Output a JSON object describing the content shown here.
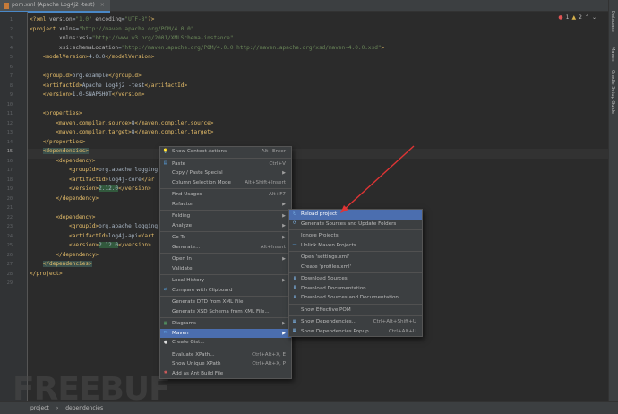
{
  "tab": {
    "title": "pom.xml (Apache Log4j2 -test)",
    "close": "×"
  },
  "inspection": {
    "errors": "1",
    "warnings": "2"
  },
  "right_tools": [
    "Database",
    "Maven",
    "Gradle Setup Guide"
  ],
  "code_lines": [
    {
      "n": "1",
      "html": "<span class=\"tg\">&lt;?xml </span><span class=\"at\">version</span>=<span class=\"av\">\"1.0\"</span> <span class=\"at\">encoding</span>=<span class=\"av\">\"UTF-8\"</span><span class=\"tg\">?&gt;</span>"
    },
    {
      "n": "2",
      "html": "<span class=\"tg\">&lt;project </span><span class=\"at\">xmlns</span>=<span class=\"av\">\"http://maven.apache.org/POM/4.0.0\"</span>"
    },
    {
      "n": "3",
      "html": "         <span class=\"at\">xmlns:xsi</span>=<span class=\"av\">\"http://www.w3.org/2001/XMLSchema-instance\"</span>"
    },
    {
      "n": "4",
      "html": "         <span class=\"at\">xsi:schemaLocation</span>=<span class=\"av\">\"http://maven.apache.org/POM/4.0.0 http://maven.apache.org/xsd/maven-4.0.0.xsd\"</span><span class=\"tg\">&gt;</span>"
    },
    {
      "n": "5",
      "html": "    <span class=\"tg\">&lt;modelVersion&gt;</span>4.0.0<span class=\"tg\">&lt;/modelVersion&gt;</span>"
    },
    {
      "n": "6",
      "html": ""
    },
    {
      "n": "7",
      "html": "    <span class=\"tg\">&lt;groupId&gt;</span>org.example<span class=\"tg\">&lt;/groupId&gt;</span>"
    },
    {
      "n": "8",
      "html": "    <span class=\"tg\">&lt;artifactId&gt;</span>Apache Log4j2 -test<span class=\"tg\">&lt;/artifactId&gt;</span>"
    },
    {
      "n": "9",
      "html": "    <span class=\"tg\">&lt;version&gt;</span>1.0-SNAPSHOT<span class=\"tg\">&lt;/version&gt;</span>"
    },
    {
      "n": "10",
      "html": ""
    },
    {
      "n": "11",
      "html": "    <span class=\"tg\">&lt;properties&gt;</span>"
    },
    {
      "n": "12",
      "html": "        <span class=\"tg\">&lt;maven.compiler.source&gt;</span>8<span class=\"tg\">&lt;/maven.compiler.source&gt;</span>"
    },
    {
      "n": "13",
      "html": "        <span class=\"tg\">&lt;maven.compiler.target&gt;</span>8<span class=\"tg\">&lt;/maven.compiler.target&gt;</span>"
    },
    {
      "n": "14",
      "html": "    <span class=\"tg\">&lt;/properties&gt;</span>"
    },
    {
      "n": "15",
      "html": "    <span class=\"tg hl\">&lt;dependencies&gt;</span>"
    },
    {
      "n": "16",
      "html": "        <span class=\"tg\">&lt;dependency&gt;</span>"
    },
    {
      "n": "17",
      "html": "            <span class=\"tg\">&lt;groupId&gt;</span>org.apache.logging"
    },
    {
      "n": "18",
      "html": "            <span class=\"tg\">&lt;artifactId&gt;</span>log4j-core<span class=\"tg\">&lt;/ar</span>"
    },
    {
      "n": "19",
      "html": "            <span class=\"tg\">&lt;version&gt;</span><span class=\"hlv\">2.12.0</span><span class=\"tg\">&lt;/version&gt;</span>"
    },
    {
      "n": "20",
      "html": "        <span class=\"tg\">&lt;/dependency&gt;</span>"
    },
    {
      "n": "21",
      "html": ""
    },
    {
      "n": "22",
      "html": "        <span class=\"tg\">&lt;dependency&gt;</span>"
    },
    {
      "n": "23",
      "html": "            <span class=\"tg\">&lt;groupId&gt;</span>org.apache.logging"
    },
    {
      "n": "24",
      "html": "            <span class=\"tg\">&lt;artifactId&gt;</span>log4j-api<span class=\"tg\">&lt;/art</span>"
    },
    {
      "n": "25",
      "html": "            <span class=\"tg\">&lt;version&gt;</span><span class=\"hlv\">2.12.0</span><span class=\"tg\">&lt;/version&gt;</span>"
    },
    {
      "n": "26",
      "html": "        <span class=\"tg\">&lt;/dependency&gt;</span>"
    },
    {
      "n": "27",
      "html": "    <span class=\"tg hl\">&lt;/dependencies&gt;</span>"
    },
    {
      "n": "28",
      "html": "<span class=\"tg\">&lt;/project&gt;</span>"
    },
    {
      "n": "29",
      "html": ""
    }
  ],
  "current_line": "15",
  "context_menu": [
    {
      "label": "Show Context Actions",
      "shortcut": "Alt+Enter",
      "icon": "bulb-icon"
    },
    {
      "sep": true
    },
    {
      "label": "Paste",
      "shortcut": "Ctrl+V",
      "icon": "paste-icon"
    },
    {
      "label": "Copy / Paste Special",
      "arrow": true
    },
    {
      "label": "Column Selection Mode",
      "shortcut": "Alt+Shift+Insert"
    },
    {
      "sep": true
    },
    {
      "label": "Find Usages",
      "shortcut": "Alt+F7"
    },
    {
      "label": "Refactor",
      "arrow": true
    },
    {
      "sep": true
    },
    {
      "label": "Folding",
      "arrow": true
    },
    {
      "label": "Analyze",
      "arrow": true
    },
    {
      "sep": true
    },
    {
      "label": "Go To",
      "arrow": true
    },
    {
      "label": "Generate...",
      "shortcut": "Alt+Insert"
    },
    {
      "sep": true
    },
    {
      "label": "Open In",
      "arrow": true
    },
    {
      "label": "Validate"
    },
    {
      "sep": true
    },
    {
      "label": "Local History",
      "arrow": true
    },
    {
      "label": "Compare with Clipboard",
      "icon": "compare-icon"
    },
    {
      "sep": true
    },
    {
      "label": "Generate DTD from XML File"
    },
    {
      "label": "Generate XSD Schema from XML File..."
    },
    {
      "sep": true
    },
    {
      "label": "Diagrams",
      "arrow": true,
      "icon": "diagram-icon"
    },
    {
      "label": "Maven",
      "arrow": true,
      "selected": true,
      "icon": "maven-icon"
    },
    {
      "label": "Create Gist...",
      "icon": "github-icon"
    },
    {
      "sep": true
    },
    {
      "label": "Evaluate XPath...",
      "shortcut": "Ctrl+Alt+X, E"
    },
    {
      "label": "Show Unique XPath",
      "shortcut": "Ctrl+Alt+X, P"
    },
    {
      "label": "Add as Ant Build File",
      "icon": "ant-icon"
    }
  ],
  "maven_submenu": [
    {
      "label": "Reload project",
      "selected": true,
      "icon": "reload-icon"
    },
    {
      "label": "Generate Sources and Update Folders",
      "icon": "generate-icon"
    },
    {
      "sep": true
    },
    {
      "label": "Ignore Projects"
    },
    {
      "label": "Unlink Maven Projects",
      "icon": "unlink-icon"
    },
    {
      "sep": true
    },
    {
      "label": "Open 'settings.xml'"
    },
    {
      "label": "Create 'profiles.xml'"
    },
    {
      "sep": true
    },
    {
      "label": "Download Sources",
      "icon": "download-icon"
    },
    {
      "label": "Download Documentation",
      "icon": "download-icon"
    },
    {
      "label": "Download Sources and Documentation",
      "icon": "download-icon"
    },
    {
      "sep": true
    },
    {
      "label": "Show Effective POM"
    },
    {
      "sep": true
    },
    {
      "label": "Show Dependencies...",
      "shortcut": "Ctrl+Alt+Shift+U",
      "icon": "dependencies-icon"
    },
    {
      "label": "Show Dependencies Popup...",
      "shortcut": "Ctrl+Alt+U",
      "icon": "dependencies-icon"
    }
  ],
  "breadcrumb": [
    "project",
    "dependencies"
  ],
  "watermark": "FREEBUF",
  "colors": {
    "selection": "#4b6eaf",
    "arrow": "#e03434",
    "tag": "#e8bf6a",
    "string": "#6a8759"
  }
}
